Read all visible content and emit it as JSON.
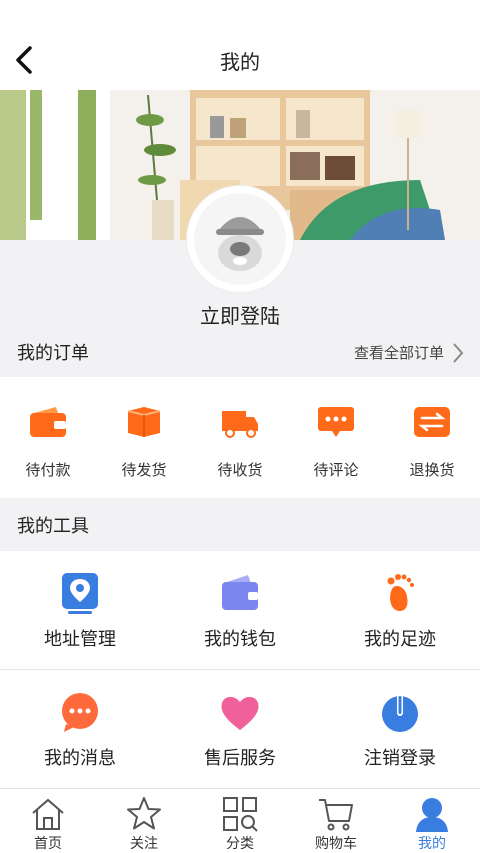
{
  "header": {
    "title": "我的"
  },
  "profile": {
    "login_label": "立即登陆"
  },
  "orders_section": {
    "title": "我的订单",
    "view_all": "查看全部订单",
    "items": [
      {
        "label": "待付款",
        "icon": "wallet-icon"
      },
      {
        "label": "待发货",
        "icon": "box-icon"
      },
      {
        "label": "待收货",
        "icon": "truck-icon"
      },
      {
        "label": "待评论",
        "icon": "comment-icon"
      },
      {
        "label": "退换货",
        "icon": "exchange-icon"
      }
    ]
  },
  "tools_section": {
    "title": "我的工具",
    "items": [
      {
        "label": "地址管理",
        "icon": "location-icon"
      },
      {
        "label": "我的钱包",
        "icon": "wallet-icon"
      },
      {
        "label": "我的足迹",
        "icon": "footprint-icon"
      },
      {
        "label": "我的消息",
        "icon": "message-icon"
      },
      {
        "label": "售后服务",
        "icon": "heart-icon"
      },
      {
        "label": "注销登录",
        "icon": "power-icon"
      }
    ]
  },
  "tabbar": {
    "items": [
      {
        "label": "首页",
        "icon": "home-icon"
      },
      {
        "label": "关注",
        "icon": "star-icon"
      },
      {
        "label": "分类",
        "icon": "category-icon"
      },
      {
        "label": "购物车",
        "icon": "cart-icon"
      },
      {
        "label": "我的",
        "icon": "user-icon"
      }
    ],
    "active_index": 4
  },
  "colors": {
    "orange": "#ff6a1a",
    "blue": "#3a7de0",
    "purple": "#7b86f0",
    "pink": "#f0609a"
  }
}
